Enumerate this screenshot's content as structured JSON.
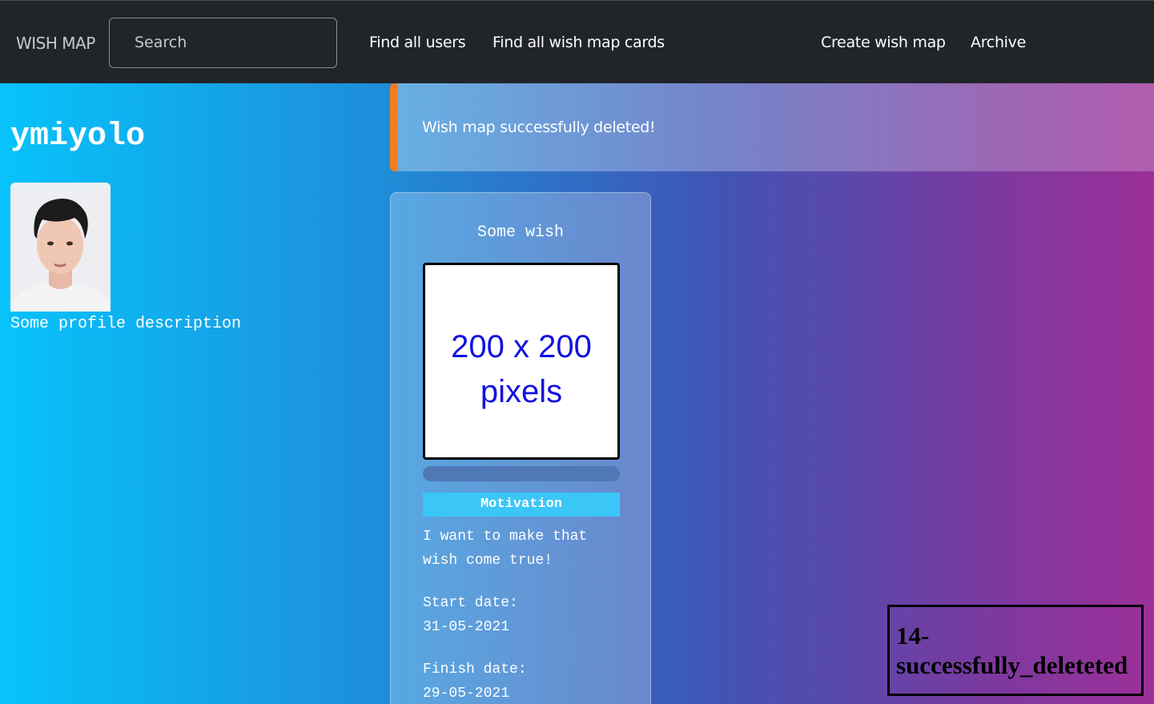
{
  "navbar": {
    "brand": "WISH MAP",
    "search_placeholder": "Search",
    "links": {
      "find_users": "Find all users",
      "find_cards": "Find all wish map cards",
      "create": "Create wish map",
      "archive": "Archive"
    }
  },
  "profile": {
    "username": "ymiyolo",
    "description": "Some profile description"
  },
  "alert": {
    "message": "Wish map successfully deleted!"
  },
  "card": {
    "title": "Some wish",
    "image_line1": "200 x 200",
    "image_line2": "pixels",
    "progress": 0,
    "motivation_label": "Motivation",
    "motivation_line1": "I want to make that",
    "motivation_line2": "wish come true!",
    "start_label": "Start date:",
    "start_value": "31-05-2021",
    "finish_label": "Finish date:",
    "finish_value": "29-05-2021"
  },
  "debug_label": {
    "line1": "14-",
    "line2": "successfully_deleteted"
  }
}
